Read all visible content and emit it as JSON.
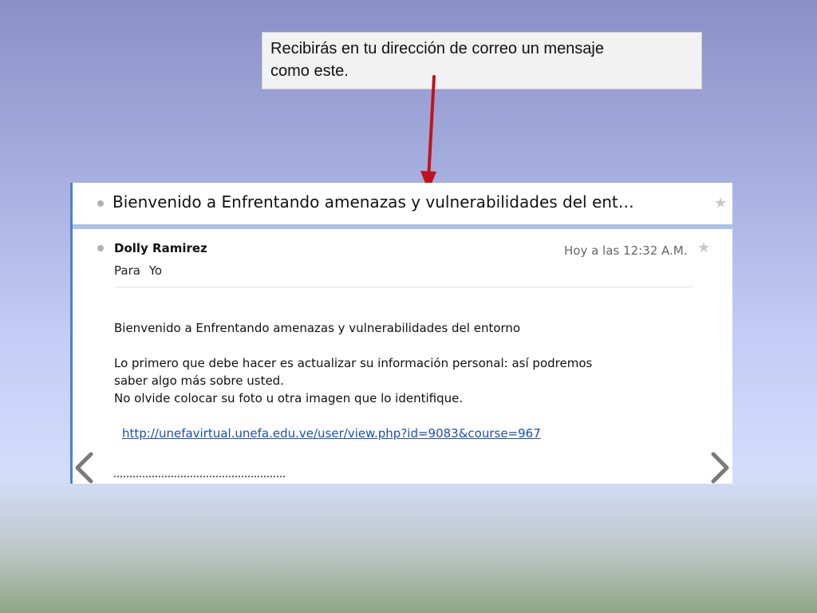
{
  "callout": {
    "line1": "Recibirás en tu dirección de correo un mensaje",
    "line2": "como este."
  },
  "email": {
    "subject": "Bienvenido a Enfrentando amenazas y vulnerabilidades del ent…",
    "sender": "Dolly Ramirez",
    "recipient_prefix": "Para",
    "recipient": "Yo",
    "timestamp": "Hoy a las 12:32 A.M.",
    "body": {
      "line1": "Bienvenido a Enfrentando amenazas y vulnerabilidades del entorno",
      "line2": "Lo primero que debe hacer es actualizar su información personal: así podremos",
      "line3": "saber algo más sobre usted.",
      "line4": "No olvide colocar su foto u otra imagen que lo identifique."
    },
    "link": "http://unefavirtual.unefa.edu.ve/user/view.php?id=9083&course=967"
  },
  "icons": {
    "star": "star-icon",
    "dot": "bullet-dot-icon",
    "prev": "chevron-left-icon",
    "next": "chevron-right-icon",
    "arrow": "red-arrow-icon"
  },
  "colors": {
    "arrow": "#c0141c",
    "link": "#1b4fb0",
    "accent_border": "#4f82c8",
    "subject_rule": "#a9c2e6",
    "nav": "#7a7a7a"
  }
}
